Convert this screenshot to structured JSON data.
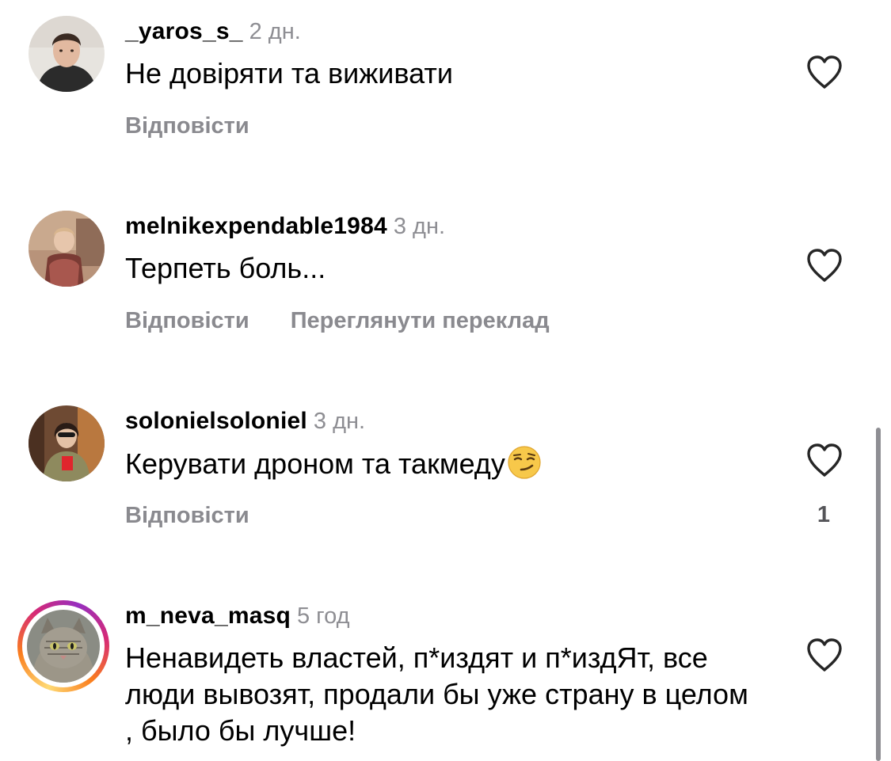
{
  "comments": [
    {
      "username": "_yaros_s_",
      "time": "2 дн.",
      "text": "Не довіряти та виживати",
      "reply_label": "Відповісти",
      "likes": ""
    },
    {
      "username": "melnikexpendable1984",
      "time": "3 дн.",
      "text": "Терпеть боль...",
      "reply_label": "Відповісти",
      "translate_label": "Переглянути переклад",
      "likes": ""
    },
    {
      "username": "solonielsoloniel",
      "time": "3 дн.",
      "text": "Керувати дроном та такмеду",
      "emoji": "smirking-face",
      "reply_label": "Відповісти",
      "likes": "1"
    },
    {
      "username": "m_neva_masq",
      "time": "5 год",
      "text": "Ненавидеть властей, п*издят и п*издЯт, все люди вывозят, продали бы уже страну в целом , было бы лучше!",
      "has_story_ring": true
    }
  ],
  "colors": {
    "text": "#000000",
    "secondary": "#8e8e93",
    "action": "#8a8a8f",
    "story_ring": [
      "#feda75",
      "#fa7e1e",
      "#d62976",
      "#962fbf"
    ]
  },
  "icons": {
    "like": "heart-outline-icon",
    "emoji": "smirking-face-emoji"
  }
}
